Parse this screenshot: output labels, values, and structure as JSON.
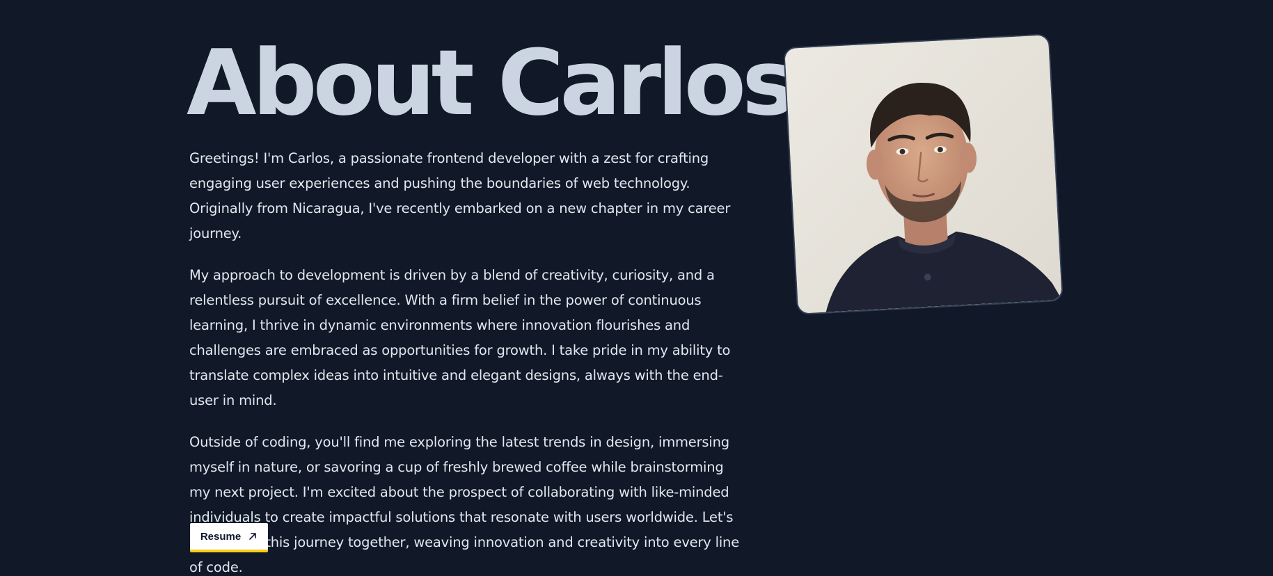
{
  "heading": {
    "title": "About Carlos"
  },
  "bio": {
    "paragraphs": [
      "Greetings! I'm Carlos, a passionate frontend developer with a zest for crafting engaging user experiences and pushing the boundaries of web technology. Originally from Nicaragua, I've recently embarked on a new chapter in my career journey.",
      "My approach to development is driven by a blend of creativity, curiosity, and a relentless pursuit of excellence. With a firm belief in the power of continuous learning, I thrive in dynamic environments where innovation flourishes and challenges are embraced as opportunities for growth. I take pride in my ability to translate complex ideas into intuitive and elegant designs, always with the end-user in mind.",
      "Outside of coding, you'll find me exploring the latest trends in design, immersing myself in nature, or savoring a cup of freshly brewed coffee while brainstorming my next project. I'm excited about the prospect of collaborating with like-minded individuals to create impactful solutions that resonate with users worldwide. Let's embark on this journey together, weaving innovation and creativity into every line of code."
    ]
  },
  "resume_button": {
    "label": "Resume",
    "icon": "arrow-up-right-icon"
  },
  "colors": {
    "background": "#111827",
    "title": "#cbd5e1",
    "text": "#e2e8f0",
    "button_accent": "#facc15"
  },
  "portrait": {
    "description_icon": "profile-photo"
  }
}
